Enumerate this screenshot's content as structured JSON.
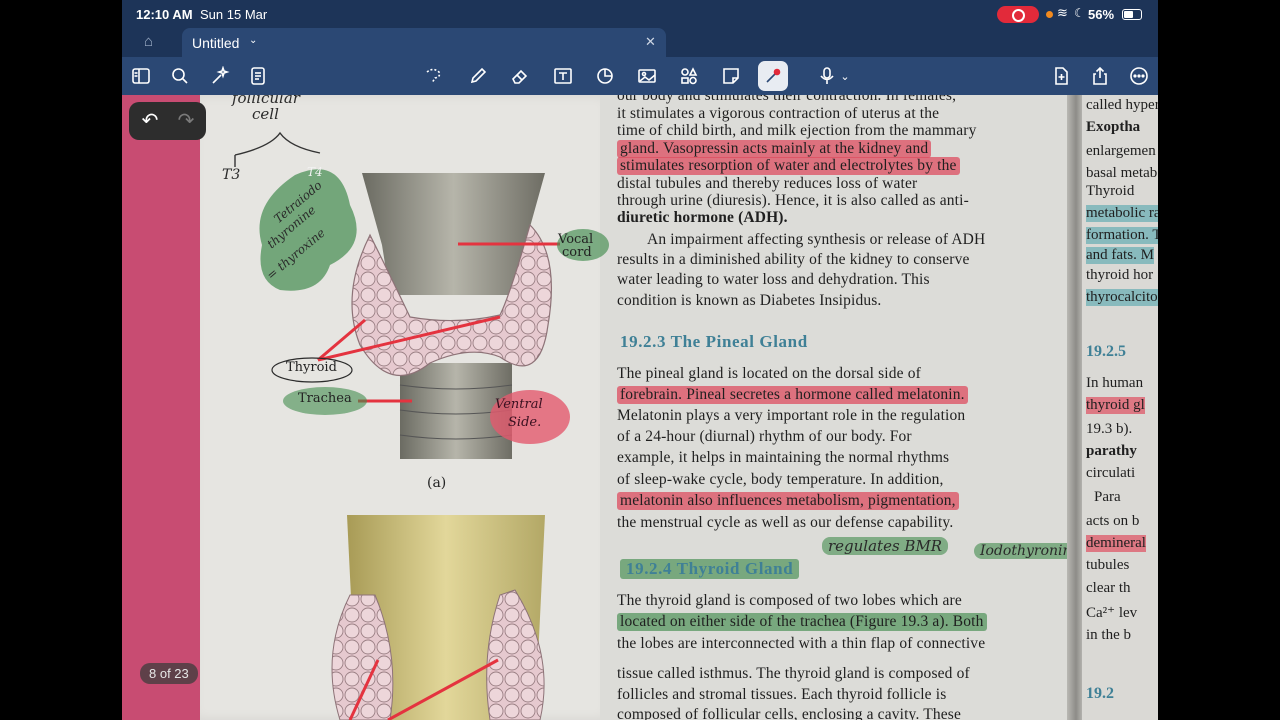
{
  "status_bar": {
    "time": "12:10 AM",
    "date": "Sun 15 Mar",
    "battery": "56%"
  },
  "tab": {
    "title": "Untitled"
  },
  "page_indicator": "8 of 23",
  "left_page": {
    "notes": {
      "follicular": "follicular",
      "cell": "cell",
      "t3": "T3",
      "t4": "T4",
      "green_note_1": "Tetraiodo",
      "green_note_2": "thyronine",
      "green_note_3": "= thyroxine",
      "ventral": "Ventral",
      "side": "Side."
    },
    "labels": {
      "vocal": "Vocal",
      "cord": "cord",
      "thyroid": "Thyroid",
      "trachea": "Trachea",
      "fig_a": "(a)"
    }
  },
  "right_page": {
    "lines": [
      "our body and stimulates their contraction. In females,",
      "it stimulates a vigorous contraction of uterus at the",
      "time of child birth, and milk ejection from the mammary",
      "gland. Vasopressin acts mainly at the kidney and",
      "stimulates resorption of water and electrolytes by the",
      "distal tubules and thereby reduces loss of water",
      "through urine (diuresis). Hence, it is also called as anti-",
      "diuretic hormone (ADH).",
      "An impairment affecting synthesis or release of ADH",
      "results in a diminished ability of the kidney to conserve",
      "water leading to water loss and dehydration. This",
      "condition is known as Diabetes Insipidus."
    ],
    "section_pineal": "19.2.3  The Pineal Gland",
    "pineal_lines": [
      "The pineal gland is located on the dorsal side of",
      "forebrain. Pineal secretes a hormone called melatonin.",
      "Melatonin plays a very important role in the regulation",
      "of a 24-hour (diurnal) rhythm of our body. For",
      "example, it helps in maintaining the normal rhythms",
      "of sleep-wake cycle, body temperature. In addition,",
      "melatonin also influences metabolism, pigmentation,",
      "the menstrual cycle as well as our defense capability."
    ],
    "margin_note": "regulates BMR",
    "margin_note_2": "Iodothyronine",
    "section_thyroid": "19.2.4  Thyroid Gland",
    "thyroid_lines": [
      "The thyroid gland is composed of two lobes which are",
      "located on either side of the trachea (Figure 19.3 a). Both",
      "the lobes are interconnected with a thin flap of connective",
      "tissue called isthmus. The thyroid gland is composed of",
      "follicles and stromal tissues. Each thyroid follicle is",
      "composed of follicular cells, enclosing a cavity. These"
    ]
  },
  "next_page": {
    "lines": [
      "called hyper",
      "Exoptha",
      "enlargemen",
      "basal metab",
      "Thyroid",
      "metabolic ra",
      "formation. T",
      "and fats. M",
      "thyroid hor",
      "thyrocalcito"
    ],
    "section": "19.2.5",
    "lines2": [
      "In human",
      "thyroid gl",
      "19.3 b).",
      "parathy",
      "circulati",
      "Para",
      "acts on b",
      "demineral",
      "tubules",
      "clear th",
      "Ca²⁺ lev",
      "in the b"
    ],
    "section2": "19.2"
  }
}
